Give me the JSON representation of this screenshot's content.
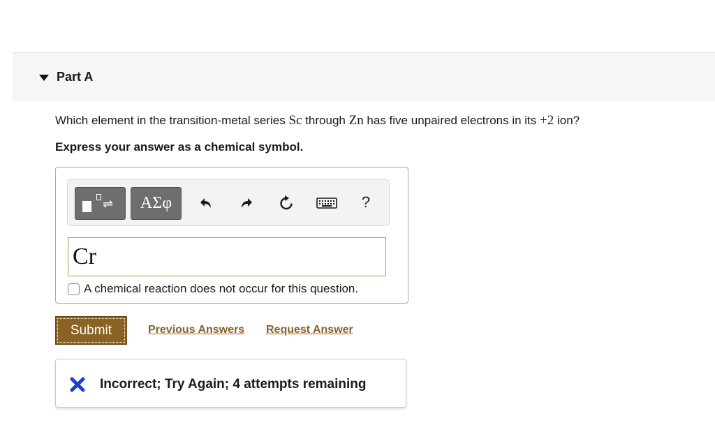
{
  "part": {
    "title": "Part A",
    "toggle_icon": "triangle-down-icon"
  },
  "question": {
    "prefix": "Which element in the transition-metal series ",
    "start_element": "Sc",
    "middle": " through ",
    "end_element": "Zn",
    "mid2": " has five unpaired electrons in its ",
    "charge": "+2",
    "suffix": " ion?"
  },
  "instruction": "Express your answer as a chemical symbol.",
  "toolbar": {
    "templates_icon": "templates-icon",
    "greek_label": "ΑΣφ",
    "undo_icon": "undo-icon",
    "redo_icon": "redo-icon",
    "reset_icon": "reset-icon",
    "keyboard_icon": "keyboard-icon",
    "help_label": "?"
  },
  "answer": {
    "value": "Cr"
  },
  "no_reaction": {
    "label": "A chemical reaction does not occur for this question.",
    "checked": false
  },
  "actions": {
    "submit_label": "Submit",
    "previous_answers": "Previous Answers",
    "request_answer": "Request Answer"
  },
  "feedback": {
    "icon": "x-icon",
    "message": "Incorrect; Try Again; 4 attempts remaining",
    "icon_color": "#1a3fd6"
  },
  "colors": {
    "accent": "#8a6223",
    "incorrect": "#1a3fd6"
  }
}
